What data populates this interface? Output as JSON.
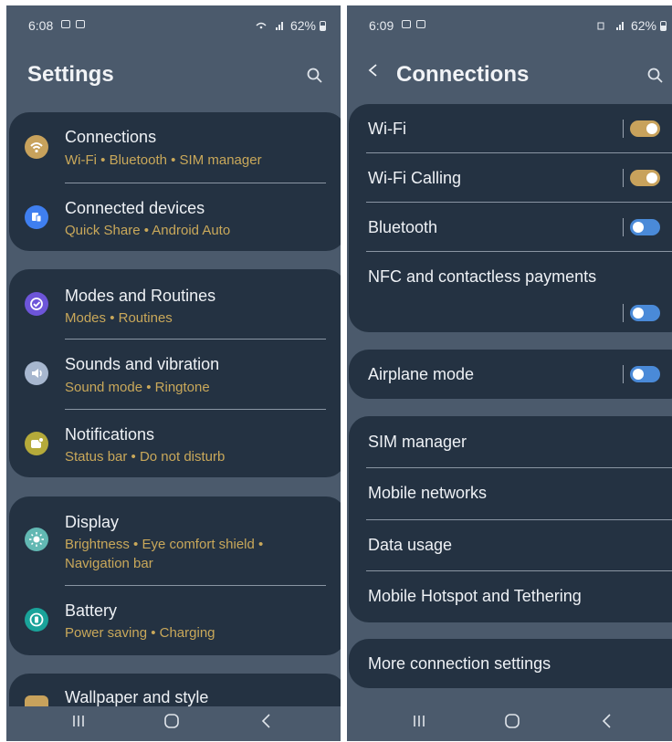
{
  "left": {
    "status": {
      "time": "6:08",
      "battery": "62%"
    },
    "title": "Settings",
    "groups": [
      [
        {
          "title": "Connections",
          "subtitle": "Wi-Fi  •  Bluetooth  •  SIM manager",
          "icon": "wifi-icon",
          "color": "#c8a25c"
        },
        {
          "title": "Connected devices",
          "subtitle": "Quick Share  •  Android Auto",
          "icon": "connected-devices-icon",
          "color": "#3f7ff0"
        }
      ],
      [
        {
          "title": "Modes and Routines",
          "subtitle": "Modes  •  Routines",
          "icon": "modes-icon",
          "color": "#6d55d9"
        },
        {
          "title": "Sounds and vibration",
          "subtitle": "Sound mode  •  Ringtone",
          "icon": "volume-icon",
          "color": "#a7b7cf"
        },
        {
          "title": "Notifications",
          "subtitle": "Status bar  •  Do not disturb",
          "icon": "notification-icon",
          "color": "#b5aa3a"
        }
      ],
      [
        {
          "title": "Display",
          "subtitle1": "Brightness  •  Eye comfort shield  •",
          "subtitle2": "Navigation bar",
          "icon": "brightness-icon",
          "color": "#62b8b3"
        },
        {
          "title": "Battery",
          "subtitle": "Power saving  •  Charging",
          "icon": "battery-icon",
          "color": "#1aa39a"
        }
      ],
      [
        {
          "title": "Wallpaper and style",
          "icon": "wallpaper-icon",
          "color": "#c8a25c"
        }
      ]
    ]
  },
  "right": {
    "status": {
      "time": "6:09",
      "battery": "62%"
    },
    "title": "Connections",
    "group1": [
      {
        "label": "Wi-Fi",
        "toggle": "on"
      },
      {
        "label": "Wi-Fi Calling",
        "toggle": "on"
      },
      {
        "label": "Bluetooth",
        "toggle": "off"
      },
      {
        "label": "NFC and contactless payments",
        "toggle": "off"
      }
    ],
    "airplane": {
      "label": "Airplane mode",
      "toggle": "off"
    },
    "group3": [
      "SIM manager",
      "Mobile networks",
      "Data usage",
      "Mobile Hotspot and Tethering"
    ],
    "more": "More connection settings"
  },
  "colors": {
    "accent": "#c8a25c",
    "toggle_off": "#4a8ad8",
    "card": "#243242",
    "bg": "#4b5a6c"
  }
}
